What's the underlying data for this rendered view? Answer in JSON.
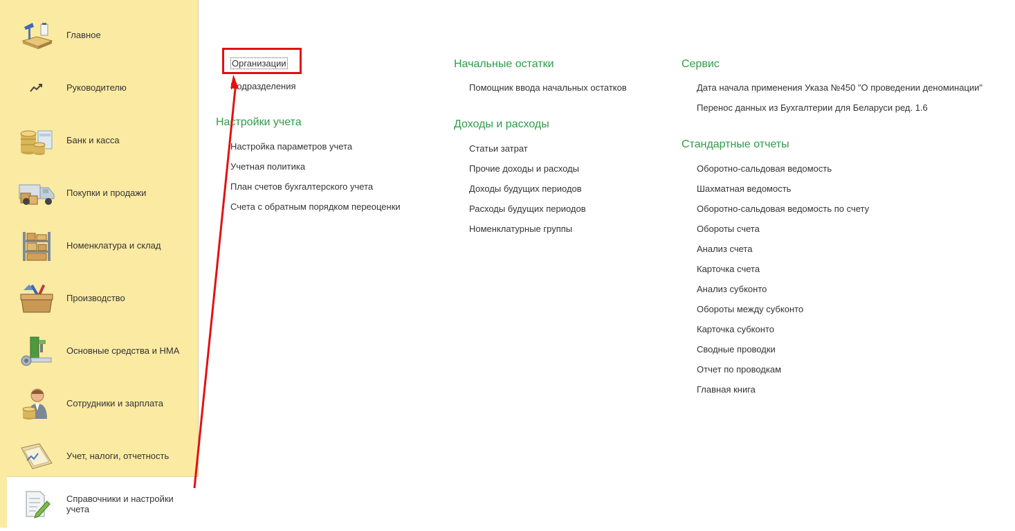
{
  "sidebar": {
    "items": [
      {
        "label": "Главное",
        "icon": "desk-lamp-icon"
      },
      {
        "label": "Руководителю",
        "icon": "trend-chart-icon"
      },
      {
        "label": "Банк и касса",
        "icon": "coins-icon"
      },
      {
        "label": "Покупки и продажи",
        "icon": "delivery-truck-icon"
      },
      {
        "label": "Номенклатура и склад",
        "icon": "warehouse-shelf-icon"
      },
      {
        "label": "Производство",
        "icon": "toolbox-icon"
      },
      {
        "label": "Основные средства и НМА",
        "icon": "machine-icon"
      },
      {
        "label": "Сотрудники и зарплата",
        "icon": "employee-icon"
      },
      {
        "label": "Учет, налоги, отчетность",
        "icon": "reports-folder-icon"
      },
      {
        "label": "Справочники и настройки учета",
        "icon": "document-pencil-icon",
        "active": true
      }
    ]
  },
  "col1": {
    "top_links": [
      "Организации",
      "Подразделения"
    ],
    "settings_heading": "Настройки учета",
    "settings_links": [
      "Настройка параметров учета",
      "Учетная политика",
      "План счетов бухгалтерского учета",
      "Счета с обратным порядком переоценки"
    ]
  },
  "col2": {
    "opening_heading": "Начальные остатки",
    "opening_links": [
      "Помощник ввода начальных остатков"
    ],
    "income_heading": "Доходы и расходы",
    "income_links": [
      "Статьи затрат",
      "Прочие доходы и расходы",
      "Доходы будущих периодов",
      "Расходы будущих периодов",
      "Номенклатурные группы"
    ]
  },
  "col3": {
    "service_heading": "Сервис",
    "service_links": [
      "Дата начала применения Указа №450 \"О проведении деноминации\"",
      "Перенос данных из Бухгалтерии для Беларуси ред. 1.6"
    ],
    "reports_heading": "Стандартные отчеты",
    "reports_links": [
      "Оборотно-сальдовая ведомость",
      "Шахматная ведомость",
      "Оборотно-сальдовая ведомость по счету",
      "Обороты счета",
      "Анализ счета",
      "Карточка счета",
      "Анализ субконто",
      "Обороты между субконто",
      "Карточка субконто",
      "Сводные проводки",
      "Отчет по проводкам",
      "Главная книга"
    ]
  },
  "colors": {
    "sidebar_bg": "#fbeaa2",
    "heading": "#2e9b4a",
    "annotation": "#e31010"
  }
}
